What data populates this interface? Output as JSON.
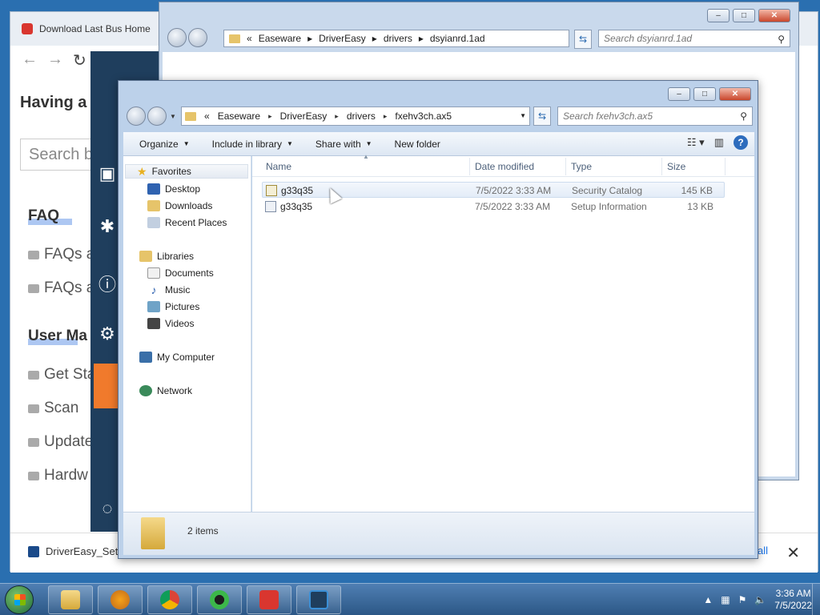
{
  "browser": {
    "tab_title": "Download Last Bus Home",
    "page": {
      "heading": "Having a",
      "search_placeholder": "Search b",
      "sections": [
        {
          "title": "FAQ",
          "links": [
            "FAQs a",
            "FAQs a"
          ]
        },
        {
          "title": "User Ma",
          "links": [
            "Get Sta",
            "Scan",
            "Update",
            "Hardw"
          ]
        }
      ]
    },
    "download": {
      "file_label": "DriverEasy_Set",
      "show_all": "all"
    }
  },
  "back_window": {
    "path": [
      "Easeware",
      "DriverEasy",
      "drivers",
      "dsyianrd.1ad"
    ],
    "search_placeholder": "Search dsyianrd.1ad"
  },
  "explorer": {
    "path": [
      "Easeware",
      "DriverEasy",
      "drivers",
      "fxehv3ch.ax5"
    ],
    "path_prefix": "«",
    "search_placeholder": "Search fxehv3ch.ax5",
    "toolbar": {
      "organize": "Organize",
      "include_in_library": "Include in library",
      "share_with": "Share with",
      "new_folder": "New folder"
    },
    "nav": {
      "favorites": "Favorites",
      "favorites_items": [
        "Desktop",
        "Downloads",
        "Recent Places"
      ],
      "libraries": "Libraries",
      "libraries_items": [
        "Documents",
        "Music",
        "Pictures",
        "Videos"
      ],
      "my_computer": "My Computer",
      "network": "Network"
    },
    "columns": {
      "name": "Name",
      "date": "Date modified",
      "type": "Type",
      "size": "Size"
    },
    "files": [
      {
        "name": "g33q35",
        "date": "7/5/2022 3:33 AM",
        "type": "Security Catalog",
        "size": "145 KB",
        "icon": "catalog-icon"
      },
      {
        "name": "g33q35",
        "date": "7/5/2022 3:33 AM",
        "type": "Setup Information",
        "size": "13 KB",
        "icon": "inf-icon"
      }
    ],
    "status": "2 items"
  },
  "taskbar": {
    "time": "3:36 AM",
    "date": "7/5/2022"
  },
  "colors": {
    "taskbar": "#2c5786",
    "driver_easy_sidebar": "#1f3e5d",
    "accent_orange": "#f07a2c"
  }
}
